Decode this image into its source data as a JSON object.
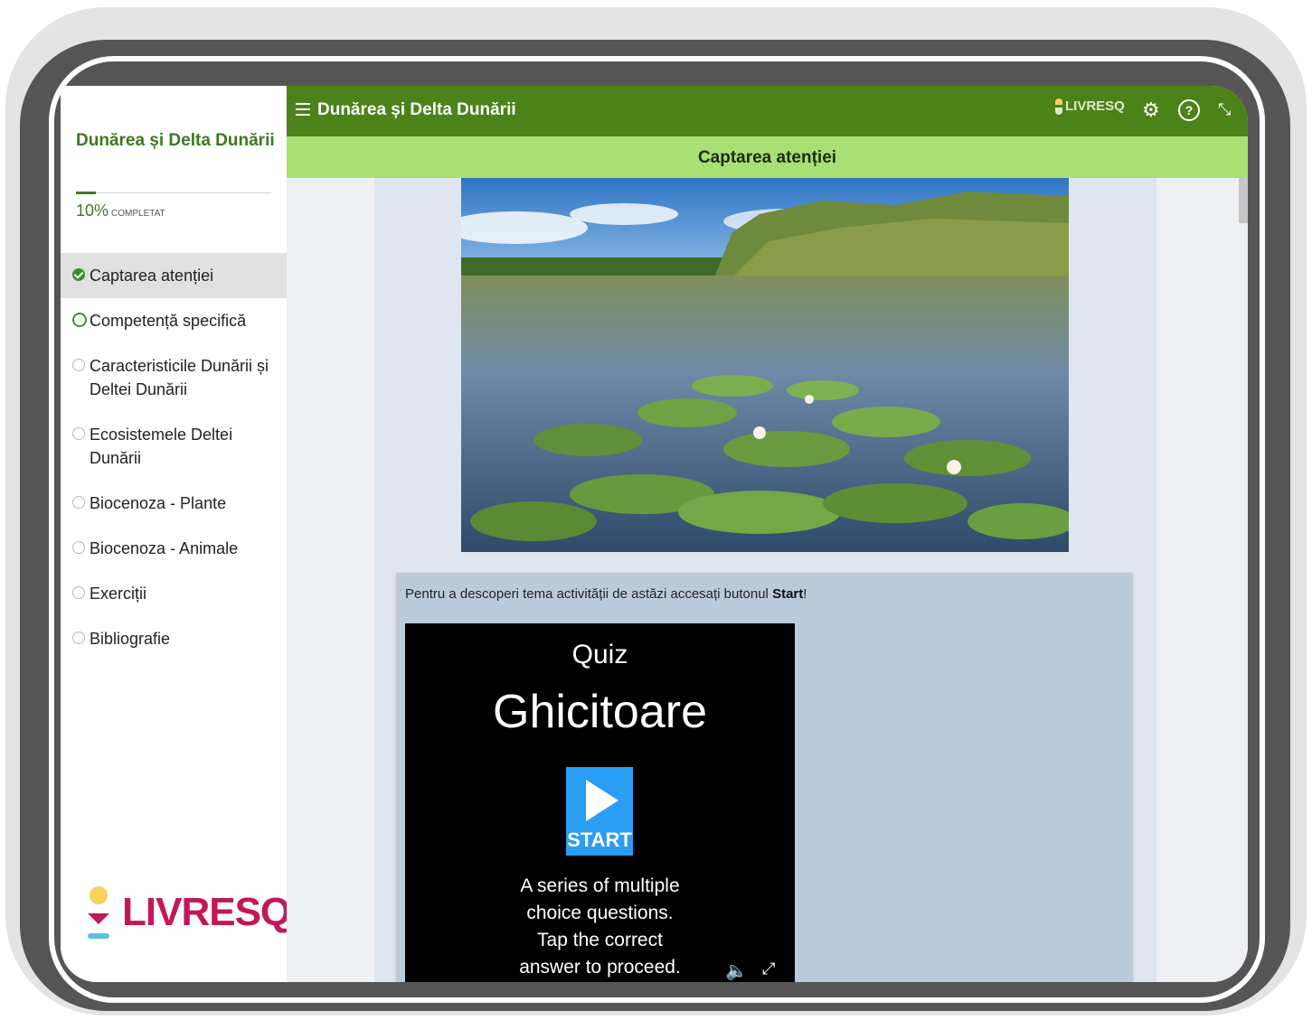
{
  "sidebar": {
    "title": "Dunărea și Delta Dunării",
    "progress": {
      "percent_text": "10%",
      "label": "COMPLETAT",
      "value": 0.1
    },
    "items": [
      {
        "label": "Captarea atenției",
        "state": "done",
        "active": true
      },
      {
        "label": "Competență specifică",
        "state": "current",
        "active": false
      },
      {
        "label": "Caracteristicile Dunării și Deltei Dunării",
        "state": "todo",
        "active": false
      },
      {
        "label": "Ecosistemele Deltei Dunării",
        "state": "todo",
        "active": false
      },
      {
        "label": "Biocenoza - Plante",
        "state": "todo",
        "active": false
      },
      {
        "label": "Biocenoza - Animale",
        "state": "todo",
        "active": false
      },
      {
        "label": "Exerciții",
        "state": "todo",
        "active": false
      },
      {
        "label": "Bibliografie",
        "state": "todo",
        "active": false
      }
    ],
    "logo_text": "LIVRESQ"
  },
  "header": {
    "title": "Dunărea și Delta Dunării",
    "brand": "LIVRESQ",
    "section_title": "Captarea atenției",
    "icons": [
      "menu-icon",
      "gear-icon",
      "help-icon",
      "fullscreen-icon"
    ]
  },
  "content": {
    "instruction_prefix": "Pentru a descoperi tema activității de astăzi accesați butonul ",
    "instruction_bold": "Start",
    "instruction_suffix": "!",
    "quiz": {
      "label": "Quiz",
      "title": "Ghicitoare",
      "start_label": "START",
      "description_lines": [
        "A series of multiple",
        "choice questions.",
        "Tap the correct",
        "answer to proceed."
      ]
    }
  },
  "colors": {
    "topbar": "#4b8219",
    "subbar": "#a9e074",
    "accent_green": "#3c7a1e",
    "logo_pink": "#c2185b",
    "start_blue": "#2a9df4"
  }
}
